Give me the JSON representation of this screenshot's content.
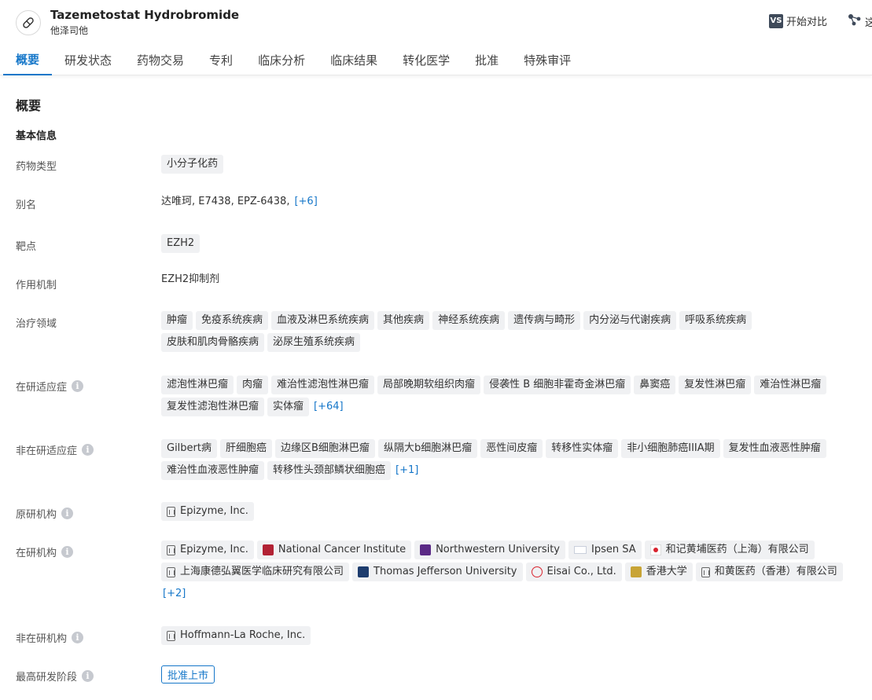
{
  "header": {
    "title": "Tazemetostat Hydrobromide",
    "subtitle": "他泽司他",
    "compare_badge": "VS",
    "compare_label": "开始对比",
    "share_label": "这"
  },
  "tabs": [
    {
      "label": "概要",
      "active": true
    },
    {
      "label": "研发状态"
    },
    {
      "label": "药物交易"
    },
    {
      "label": "专利"
    },
    {
      "label": "临床分析"
    },
    {
      "label": "临床结果"
    },
    {
      "label": "转化医学"
    },
    {
      "label": "批准"
    },
    {
      "label": "特殊审评"
    }
  ],
  "overview": {
    "section_title": "概要",
    "basic_info_title": "基本信息",
    "drug_type": {
      "label": "药物类型",
      "tags": [
        "小分子化药"
      ]
    },
    "aliases": {
      "label": "别名",
      "text": "达唯珂,  E7438,  EPZ-6438,",
      "more": "[+6]"
    },
    "target": {
      "label": "靶点",
      "tags": [
        "EZH2"
      ]
    },
    "mechanism": {
      "label": "作用机制",
      "text": "EZH2抑制剂"
    },
    "therapeutic_areas": {
      "label": "治疗领域",
      "tags": [
        "肿瘤",
        "免疫系统疾病",
        "血液及淋巴系统疾病",
        "其他疾病",
        "神经系统疾病",
        "遗传病与畸形",
        "内分泌与代谢疾病",
        "呼吸系统疾病",
        "皮肤和肌肉骨骼疾病",
        "泌尿生殖系统疾病"
      ]
    },
    "active_indications": {
      "label": "在研适应症",
      "info": "i",
      "tags": [
        "滤泡性淋巴瘤",
        "肉瘤",
        "难治性滤泡性淋巴瘤",
        "局部晚期软组织肉瘤",
        "侵袭性 B 细胞非霍奇金淋巴瘤",
        "鼻窦癌",
        "复发性淋巴瘤",
        "难治性淋巴瘤",
        "复发性滤泡性淋巴瘤",
        "实体瘤"
      ],
      "more": "[+64]"
    },
    "inactive_indications": {
      "label": "非在研适应症",
      "info": "i",
      "tags": [
        "Gilbert病",
        "肝细胞癌",
        "边缘区B细胞淋巴瘤",
        "纵隔大b细胞淋巴瘤",
        "恶性间皮瘤",
        "转移性实体瘤",
        "非小细胞肺癌IIIA期",
        "复发性血液恶性肿瘤",
        "难治性血液恶性肿瘤",
        "转移性头颈部鳞状细胞癌"
      ],
      "more": "[+1]"
    },
    "originator": {
      "label": "原研机构",
      "info": "i",
      "orgs": [
        {
          "name": "Epizyme, Inc.",
          "icon": "building-icon"
        }
      ]
    },
    "active_orgs": {
      "label": "在研机构",
      "info": "i",
      "orgs": [
        {
          "name": "Epizyme, Inc.",
          "icon": "building-icon"
        },
        {
          "name": "National Cancer Institute",
          "icon": "nci-logo-icon"
        },
        {
          "name": "Northwestern University",
          "icon": "northwestern-logo-icon"
        },
        {
          "name": "Ipsen SA",
          "icon": "ipsen-logo-icon"
        },
        {
          "name": "和记黄埔医药（上海）有限公司",
          "icon": "hutchmed-logo-icon"
        },
        {
          "name": "上海康德弘翼医学临床研究有限公司",
          "icon": "building-icon"
        },
        {
          "name": "Thomas Jefferson University",
          "icon": "tju-logo-icon"
        },
        {
          "name": "Eisai Co., Ltd.",
          "icon": "eisai-logo-icon"
        },
        {
          "name": "香港大学",
          "icon": "hku-logo-icon"
        },
        {
          "name": "和黄医药（香港）有限公司",
          "icon": "building-icon"
        }
      ],
      "more": "[+2]"
    },
    "inactive_orgs": {
      "label": "非在研机构",
      "info": "i",
      "orgs": [
        {
          "name": "Hoffmann-La Roche, Inc.",
          "icon": "building-icon"
        }
      ]
    },
    "highest_phase": {
      "label": "最高研发阶段",
      "info": "i",
      "value": "批准上市"
    }
  },
  "colors": {
    "accent": "#1677c9",
    "tag_bg": "#f0f1f3",
    "info_icon": "#c6c9cf"
  }
}
